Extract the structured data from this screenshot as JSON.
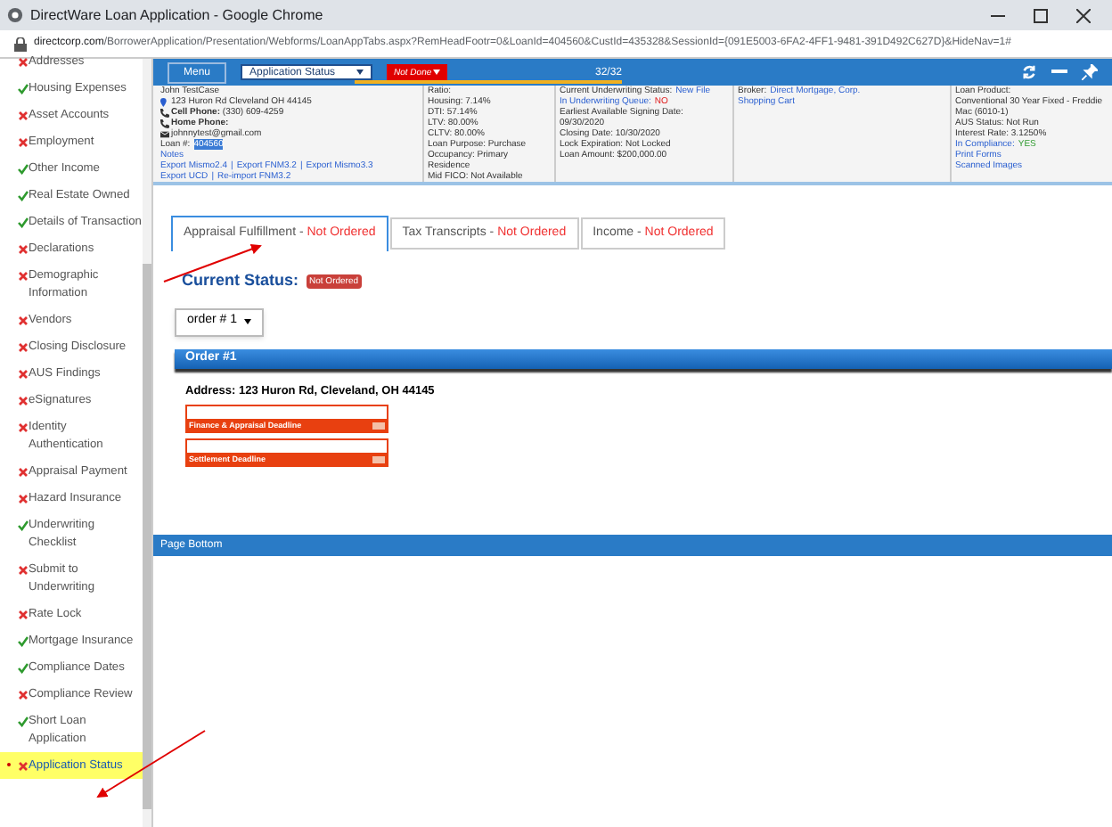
{
  "window": {
    "title": "DirectWare Loan Application - Google Chrome",
    "url_host": "directcorp.com",
    "url_path": "/BorrowerApplication/Presentation/Webforms/LoanAppTabs.aspx?RemHeadFootr=0&LoanId=404560&CustId=435328&SessionId={091E5003-6FA2-4FF1-9481-391D492C627D}&HideNav=1#"
  },
  "sidebar": {
    "items": [
      {
        "label": "Addresses",
        "done": false,
        "selected": false
      },
      {
        "label": "Housing Expenses",
        "done": true,
        "selected": false
      },
      {
        "label": "Asset Accounts",
        "done": false,
        "selected": false
      },
      {
        "label": "Employment",
        "done": false,
        "selected": false
      },
      {
        "label": "Other Income",
        "done": true,
        "selected": false
      },
      {
        "label": "Real Estate Owned",
        "done": true,
        "selected": false
      },
      {
        "label": "Details of Transaction",
        "done": true,
        "selected": false
      },
      {
        "label": "Declarations",
        "done": false,
        "selected": false
      },
      {
        "label": "Demographic Information",
        "done": false,
        "selected": false
      },
      {
        "label": "Vendors",
        "done": false,
        "selected": false
      },
      {
        "label": "Closing Disclosure",
        "done": false,
        "selected": false
      },
      {
        "label": "AUS Findings",
        "done": false,
        "selected": false
      },
      {
        "label": "eSignatures",
        "done": false,
        "selected": false
      },
      {
        "label": "Identity Authentication",
        "done": false,
        "selected": false
      },
      {
        "label": "Appraisal Payment",
        "done": false,
        "selected": false
      },
      {
        "label": "Hazard Insurance",
        "done": false,
        "selected": false
      },
      {
        "label": "Underwriting Checklist",
        "done": true,
        "selected": false
      },
      {
        "label": "Submit to Underwriting",
        "done": false,
        "selected": false
      },
      {
        "label": "Rate Lock",
        "done": false,
        "selected": false
      },
      {
        "label": "Mortgage Insurance",
        "done": true,
        "selected": false
      },
      {
        "label": "Compliance Dates",
        "done": true,
        "selected": false
      },
      {
        "label": "Compliance Review",
        "done": false,
        "selected": false
      },
      {
        "label": "Short Loan Application",
        "done": true,
        "selected": false
      },
      {
        "label": "Application Status",
        "done": false,
        "selected": true
      }
    ]
  },
  "toolbar": {
    "menu": "Menu",
    "status_dropdown": "Application Status",
    "done_dropdown": "Not Done",
    "progress": {
      "text": "32/32",
      "level": 1
    }
  },
  "info": {
    "columns": [
      [
        {
          "kind": "name",
          "text": "John TestCase"
        },
        {
          "kind": "address",
          "text": "123 Huron Rd Cleveland OH 44145"
        },
        {
          "kind": "phone",
          "text": "**Cell Phone:** (330) 609-4259"
        },
        {
          "kind": "phone",
          "text": "**Home Phone:**"
        },
        {
          "kind": "email",
          "text": "johnnytest@gmail.com"
        },
        {
          "kind": "loan",
          "label": "Loan #:",
          "value": "404560"
        },
        {
          "kind": "links",
          "links": [
            "Notes"
          ]
        },
        {
          "kind": "links",
          "links": [
            "Export Mismo2.4",
            "Export FNM3.2",
            "Export Mismo3.3"
          ],
          "separator": "|"
        },
        {
          "kind": "links",
          "links": [
            "Export UCD",
            "Re-import FNM3.2"
          ],
          "separator": "|"
        }
      ],
      [
        {
          "kind": "text",
          "text": "Ratio:"
        },
        {
          "kind": "text",
          "text": "Housing: 7.14%"
        },
        {
          "kind": "text",
          "text": "DTI: 57.14%"
        },
        {
          "kind": "text",
          "text": "LTV: 80.00%"
        },
        {
          "kind": "text",
          "text": "CLTV: 80.00%"
        },
        {
          "kind": "text",
          "text": "Loan Purpose: Purchase"
        },
        {
          "kind": "text",
          "text": "Occupancy: Primary Residence"
        },
        {
          "kind": "text",
          "text": "Mid FICO: Not Available"
        }
      ],
      [
        {
          "kind": "pair",
          "label": "Current Underwriting Status:",
          "value": "New File"
        },
        {
          "kind": "alert",
          "label": "In Underwriting Queue:",
          "value": "NO"
        },
        {
          "kind": "text",
          "text": "Earliest Available Signing Date:"
        },
        {
          "kind": "text",
          "text": "09/30/2020"
        },
        {
          "kind": "text",
          "text": "Closing Date: 10/30/2020"
        },
        {
          "kind": "text",
          "text": "Lock Expiration: Not Locked"
        },
        {
          "kind": "text",
          "text": "Loan Amount: $200,000.00"
        }
      ],
      [
        {
          "kind": "pair",
          "label": "Broker:",
          "value": "Direct Mortgage, Corp."
        },
        {
          "kind": "links",
          "links": [
            "Shopping Cart"
          ]
        }
      ],
      [
        {
          "kind": "text",
          "text": "Loan Product:"
        },
        {
          "kind": "text",
          "text": "Conventional 30 Year Fixed - Freddie Mac (6010-1)"
        },
        {
          "kind": "text",
          "text": "AUS Status: Not Run"
        },
        {
          "kind": "text",
          "text": "Interest Rate: 3.1250%"
        },
        {
          "kind": "ok",
          "label": "In Compliance:",
          "value": "YES"
        },
        {
          "kind": "links",
          "links": [
            "Print Forms"
          ]
        },
        {
          "kind": "links",
          "links": [
            "Scanned Images"
          ]
        }
      ]
    ]
  },
  "tabs": [
    {
      "label": "Appraisal Fulfillment",
      "separator": "-",
      "status": "Not Ordered",
      "selected": true
    },
    {
      "label": "Tax Transcripts",
      "separator": "-",
      "status": "Not Ordered",
      "selected": false
    },
    {
      "label": "Income",
      "separator": "-",
      "status": "Not Ordered",
      "selected": false
    }
  ],
  "current_status": {
    "label": "Current Status:",
    "badge": "Not Ordered"
  },
  "order_dropdown": "order # 1",
  "order": {
    "title": "Order #1",
    "address": "Address: 123 Huron Rd, Cleveland, OH 44145",
    "deadlines": [
      "Finance & Appraisal Deadline",
      "Settlement Deadline"
    ]
  },
  "page_bottom": "Page Bottom"
}
